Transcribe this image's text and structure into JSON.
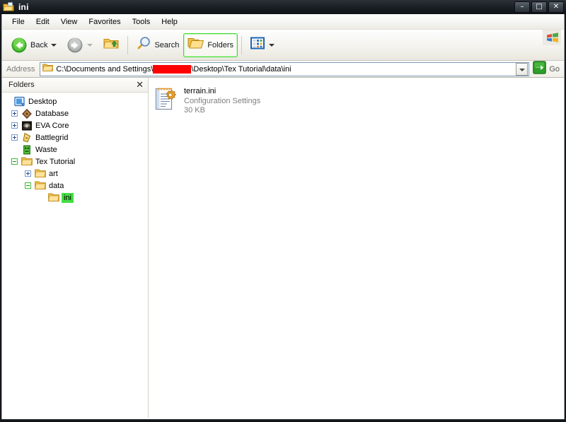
{
  "window": {
    "title": "ini",
    "title_icon": "folder-open-icon",
    "controls": {
      "minimize": "–",
      "maximize": "□",
      "close": "✕"
    }
  },
  "menu": {
    "items": [
      {
        "label": "File"
      },
      {
        "label": "Edit"
      },
      {
        "label": "View"
      },
      {
        "label": "Favorites"
      },
      {
        "label": "Tools"
      },
      {
        "label": "Help"
      }
    ]
  },
  "toolbar": {
    "back_label": "Back",
    "forward_label": "",
    "up_label": "",
    "search_label": "Search",
    "folders_label": "Folders",
    "views_label": ""
  },
  "address": {
    "label": "Address",
    "path_before": "C:\\Documents and Settings\\",
    "path_after": "\\Desktop\\Tex Tutorial\\data\\ini",
    "redacted": true,
    "go_label": "Go"
  },
  "tree": {
    "header": "Folders",
    "close": "✕",
    "items": [
      {
        "label": "Desktop",
        "indent": 0,
        "expander": "none",
        "icon": "desktop-icon",
        "selected": false
      },
      {
        "label": "Database",
        "indent": 1,
        "expander": "plus",
        "icon": "database-icon",
        "selected": false
      },
      {
        "label": "EVA Core",
        "indent": 1,
        "expander": "plus",
        "icon": "eva-core-icon",
        "selected": false
      },
      {
        "label": "Battlegrid",
        "indent": 1,
        "expander": "plus",
        "icon": "battlegrid-icon",
        "selected": false
      },
      {
        "label": "Waste",
        "indent": 1,
        "expander": "none",
        "icon": "waste-icon",
        "selected": false
      },
      {
        "label": "Tex Tutorial",
        "indent": 1,
        "expander": "minus-green",
        "icon": "folder-icon",
        "selected": false
      },
      {
        "label": "art",
        "indent": 2,
        "expander": "plus",
        "icon": "folder-icon",
        "selected": false
      },
      {
        "label": "data",
        "indent": 2,
        "expander": "minus-green",
        "icon": "folder-icon",
        "selected": false
      },
      {
        "label": "ini",
        "indent": 3,
        "expander": "none",
        "icon": "folder-icon",
        "selected": true
      }
    ]
  },
  "files": {
    "items": [
      {
        "name": "terrain.ini",
        "type": "Configuration Settings",
        "size": "30 KB",
        "icon": "ini-file-icon"
      }
    ]
  },
  "colors": {
    "selection_green": "#44dd44",
    "redaction_red": "#ff0000",
    "accent_green": "#3ddd2e",
    "titlebar_dark": "#1b2026"
  }
}
